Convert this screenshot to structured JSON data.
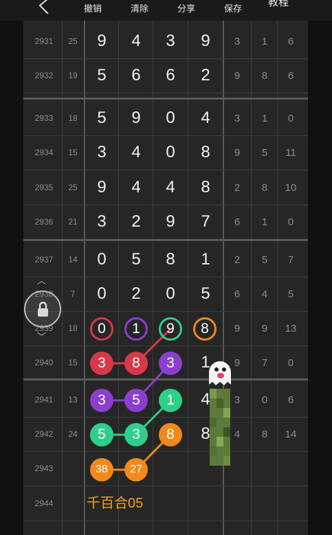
{
  "toolbar": {
    "undo_label": "撤销",
    "clear_label": "清除",
    "share_label": "分享",
    "save_label": "保存",
    "tutorial_label": "教程"
  },
  "rows": [
    {
      "issue": "2931",
      "sum": "25",
      "digits": [
        "9",
        "4",
        "3",
        "9"
      ],
      "stats": [
        "3",
        "1",
        "6"
      ]
    },
    {
      "issue": "2932",
      "sum": "19",
      "digits": [
        "5",
        "6",
        "6",
        "2"
      ],
      "stats": [
        "9",
        "8",
        "6"
      ]
    },
    {
      "issue": "2933",
      "sum": "18",
      "digits": [
        "5",
        "9",
        "0",
        "4"
      ],
      "stats": [
        "3",
        "1",
        "0"
      ]
    },
    {
      "issue": "2934",
      "sum": "15",
      "digits": [
        "3",
        "4",
        "0",
        "8"
      ],
      "stats": [
        "9",
        "5",
        "11"
      ]
    },
    {
      "issue": "2935",
      "sum": "25",
      "digits": [
        "9",
        "4",
        "4",
        "8"
      ],
      "stats": [
        "2",
        "8",
        "10"
      ]
    },
    {
      "issue": "2936",
      "sum": "21",
      "digits": [
        "3",
        "2",
        "9",
        "7"
      ],
      "stats": [
        "6",
        "1",
        "0"
      ]
    },
    {
      "issue": "2937",
      "sum": "14",
      "digits": [
        "0",
        "5",
        "8",
        "1"
      ],
      "stats": [
        "2",
        "5",
        "7"
      ]
    },
    {
      "issue": "2938",
      "sum": "7",
      "digits": [
        "0",
        "2",
        "0",
        "5"
      ],
      "stats": [
        "6",
        "4",
        "5"
      ]
    },
    {
      "issue": "2939",
      "sum": "18",
      "digits": [
        "",
        "",
        "",
        ""
      ],
      "stats": [
        "9",
        "9",
        "13"
      ]
    },
    {
      "issue": "2940",
      "sum": "15",
      "digits": [
        "",
        "",
        "",
        "1"
      ],
      "stats": [
        "9",
        "7",
        "0"
      ]
    },
    {
      "issue": "2941",
      "sum": "13",
      "digits": [
        "",
        "",
        "",
        "4"
      ],
      "stats": [
        "3",
        "0",
        "6"
      ]
    },
    {
      "issue": "2942",
      "sum": "24",
      "digits": [
        "",
        "",
        "",
        "8"
      ],
      "stats": [
        "4",
        "8",
        "14"
      ]
    },
    {
      "issue": "2943",
      "sum": "",
      "digits": [
        "",
        "",
        "",
        ""
      ],
      "stats": [
        "",
        "",
        ""
      ]
    },
    {
      "issue": "2944",
      "sum": "",
      "digits": [
        "",
        "",
        "",
        ""
      ],
      "stats": [
        "",
        "",
        ""
      ]
    }
  ],
  "marks": {
    "ring_0": "0",
    "ring_1": "1",
    "ring_9": "9",
    "ring_8": "8",
    "b_3a": "3",
    "b_8a": "8",
    "b_3b": "3",
    "b_3c": "3",
    "b_5a": "5",
    "b_1a": "1",
    "b_5b": "5",
    "b_3d": "3",
    "b_8b": "8",
    "b_38": "38",
    "b_27": "27"
  },
  "note": "千百合05",
  "colors": {
    "red": "#d63a48",
    "purple": "#8a3fcf",
    "green": "#2fcf8a",
    "orange": "#f08a1a"
  },
  "icons": {
    "back": "chevron-left-icon",
    "lock": "lock-icon",
    "ghost": "ghost-sticker-icon"
  }
}
